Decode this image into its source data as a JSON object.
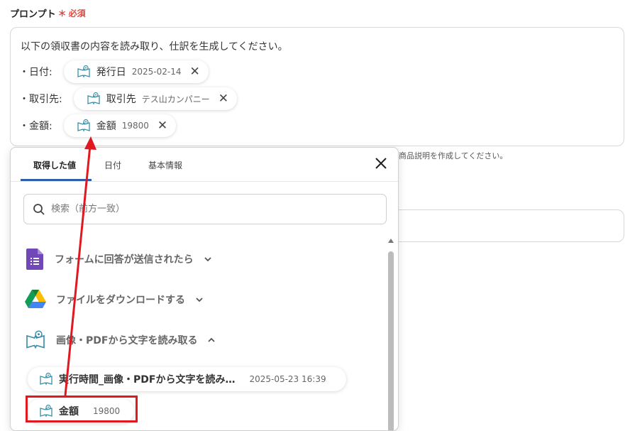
{
  "field": {
    "label": "プロンプト",
    "required_mark": "＊",
    "required_text": "必須"
  },
  "prompt": {
    "intro": "以下の領収書の内容を読み取り、仕訳を生成してください。",
    "rows": [
      {
        "label": "・日付:",
        "var_name": "発行日",
        "var_value": "2025-02-14"
      },
      {
        "label": "・取引先:",
        "var_name": "取引先",
        "var_value": "テス山カンパニー"
      },
      {
        "label": "・金額:",
        "var_name": "金額",
        "var_value": "19800"
      }
    ]
  },
  "helper_text": "商品説明を作成してください。",
  "panel": {
    "tabs": [
      "取得した値",
      "日付",
      "基本情報"
    ],
    "active_tab": "取得した値",
    "search_placeholder": "検索（前方一致）",
    "sections": [
      {
        "label": "フォームに回答が送信されたら",
        "icon": "google-forms-icon",
        "expanded": false
      },
      {
        "label": "ファイルをダウンロードする",
        "icon": "google-drive-icon",
        "expanded": false
      },
      {
        "label": "画像・PDFから文字を読み取る",
        "icon": "ocr-book-icon",
        "expanded": true
      }
    ],
    "items": [
      {
        "name": "実行時間_画像・PDFから文字を読み…",
        "value": "2025-05-23 16:39"
      },
      {
        "name": "金額",
        "value": "19800"
      }
    ]
  },
  "colors": {
    "required": "#e8473f",
    "accent": "#2b5fa8",
    "highlight": "#e0181f",
    "icon_teal": "#3a8fa8"
  }
}
